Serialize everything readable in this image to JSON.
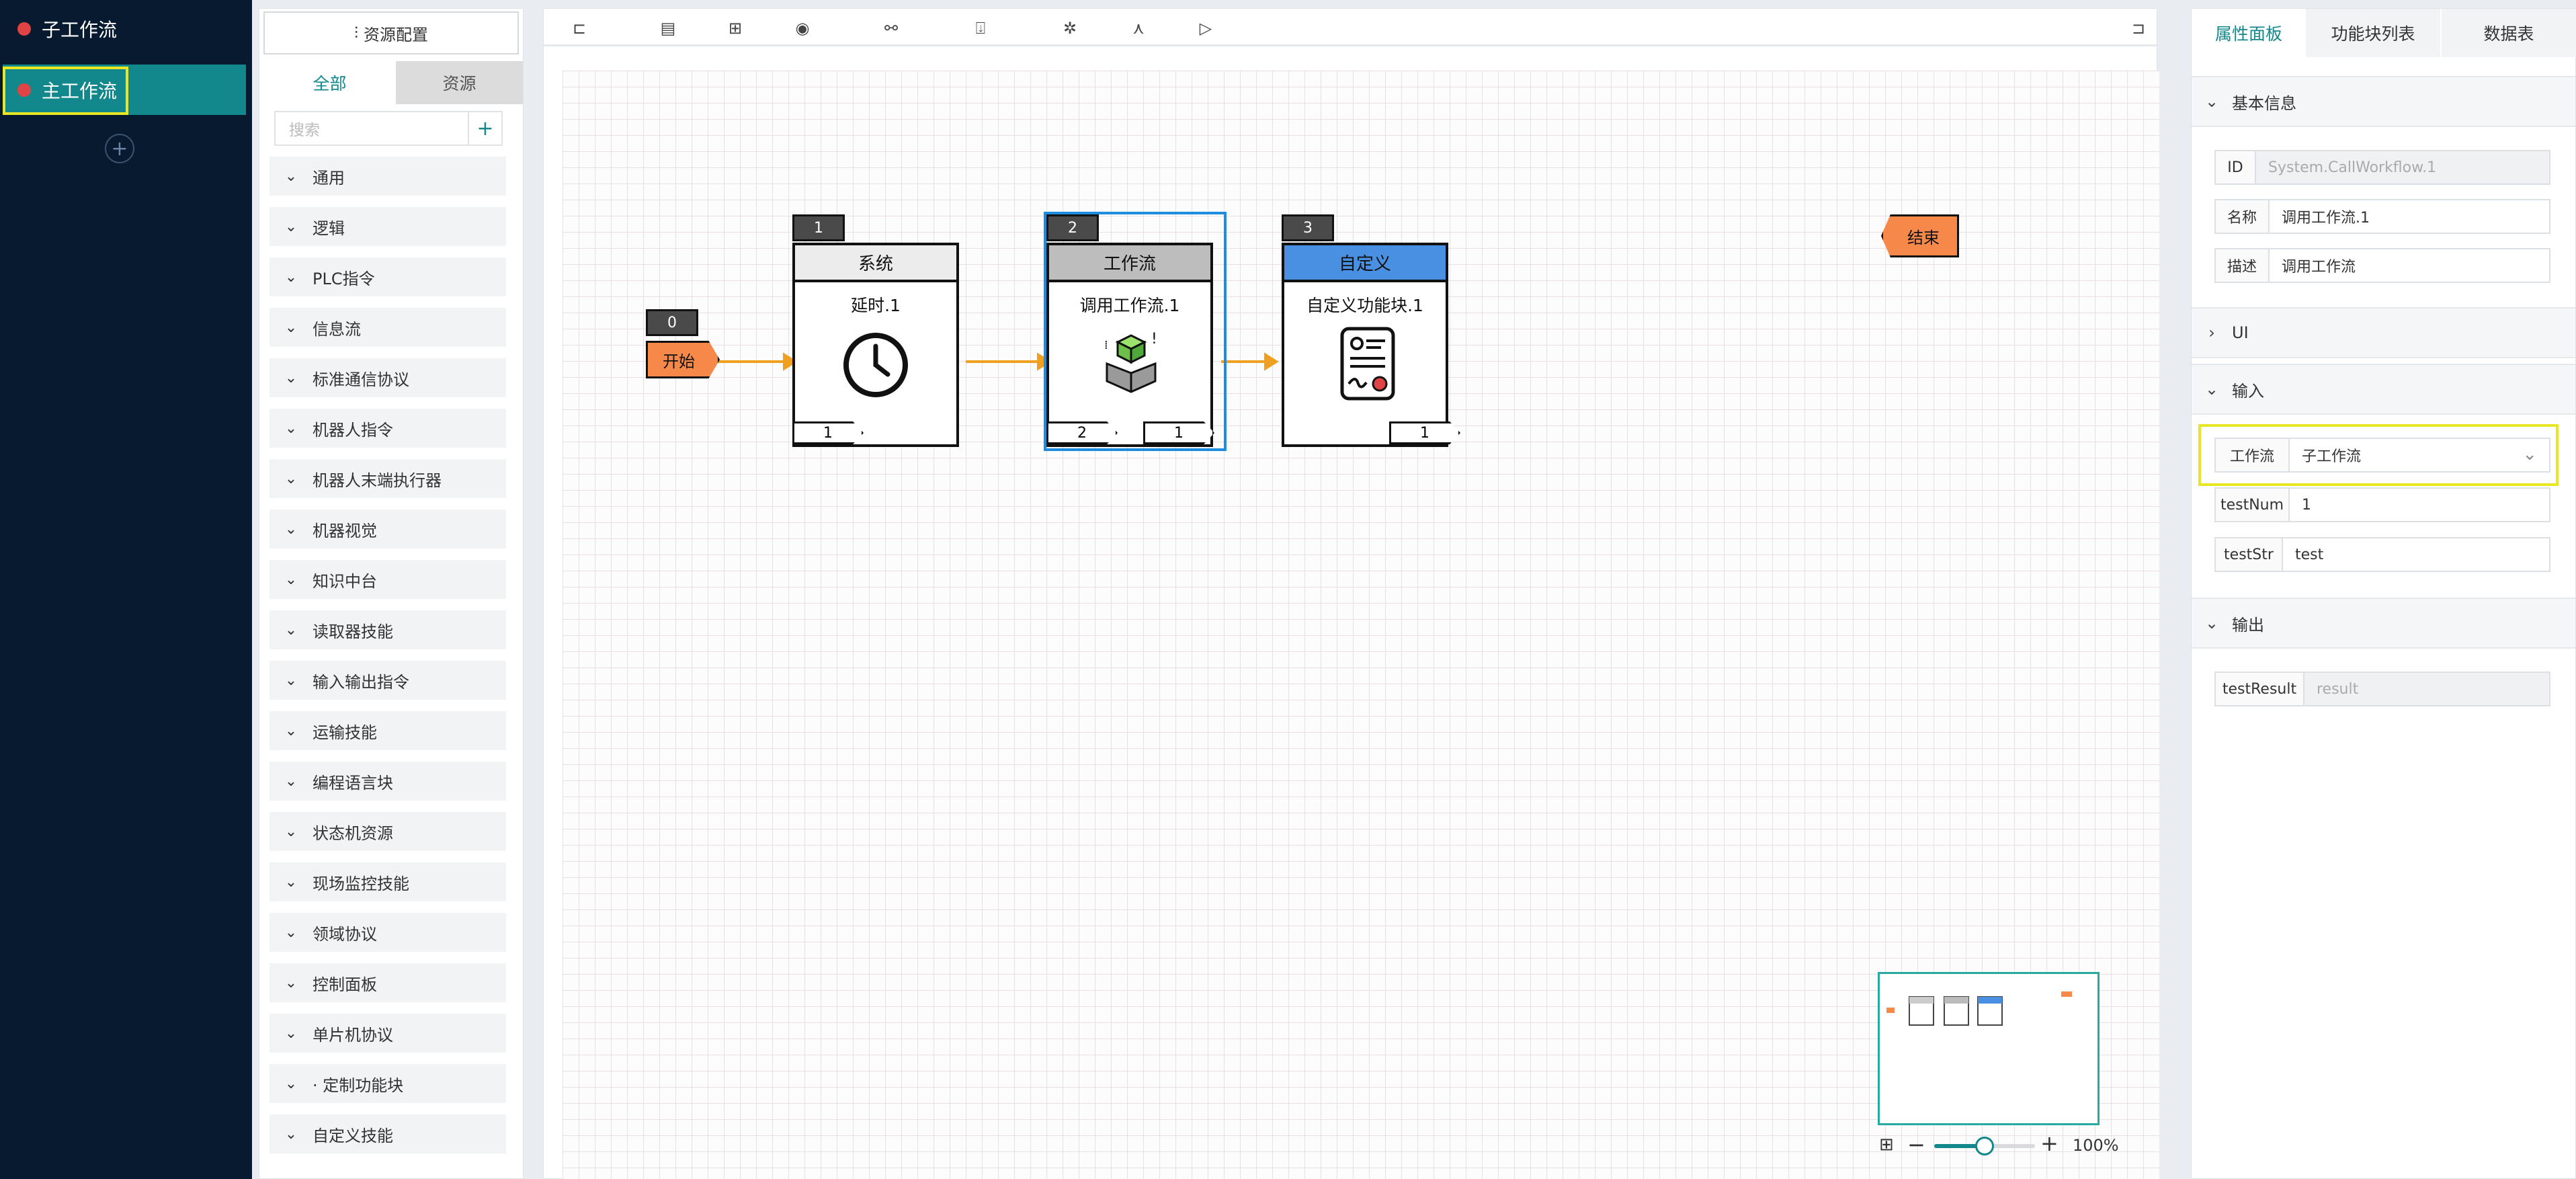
{
  "workflows": {
    "sub": {
      "label": "子工作流",
      "dot_color": "#e04343"
    },
    "main": {
      "label": "主工作流",
      "dot_color": "#e04343"
    },
    "add_symbol": "+"
  },
  "resources": {
    "header": "资源配置",
    "tabs": {
      "all": "全部",
      "resources": "资源"
    },
    "search_placeholder": "搜索",
    "search_add": "+",
    "categories": [
      "通用",
      "逻辑",
      "PLC指令",
      "信息流",
      "标准通信协议",
      "机器人指令",
      "机器人末端执行器",
      "机器视觉",
      "知识中台",
      "读取器技能",
      "输入输出指令",
      "运输技能",
      "编程语言块",
      "状态机资源",
      "现场监控技能",
      "领域协议",
      "控制面板",
      "单片机协议",
      "· 定制功能块",
      "自定义技能"
    ]
  },
  "toolbar": {
    "icons": [
      "collapse-left-icon",
      "save-icon",
      "grid-layout-icon",
      "eye-icon",
      "link-icon",
      "export-icon",
      "debug-icon",
      "graph-icon",
      "run-icon",
      "collapse-right-icon"
    ]
  },
  "canvas": {
    "start": {
      "index": "0",
      "label": "开始"
    },
    "end": {
      "label": "结束"
    },
    "nodes": [
      {
        "index": "1",
        "category": "系统",
        "name": "延时.1",
        "ports_out": [
          "1"
        ],
        "header_color": "#ececec"
      },
      {
        "index": "2",
        "category": "工作流",
        "name": "调用工作流.1",
        "ports_out": [
          "2",
          "1"
        ],
        "header_color": "#bdbdbd"
      },
      {
        "index": "3",
        "category": "自定义",
        "name": "自定义功能块.1",
        "ports_out": [
          "1"
        ],
        "header_color": "#4a90e2"
      }
    ],
    "colors": {
      "accent": "#13888c",
      "start_end": "#f6894a",
      "edge": "#f0a020",
      "selection": "#1e8de0"
    }
  },
  "zoom": {
    "minus": "−",
    "plus": "+",
    "value": "100%",
    "level": 0.5
  },
  "properties": {
    "tabs": {
      "attr": "属性面板",
      "blocks": "功能块列表",
      "data": "数据表"
    },
    "basic": {
      "title": "基本信息",
      "id_label": "ID",
      "id_value": "System.CallWorkflow.1",
      "name_label": "名称",
      "name_value": "调用工作流.1",
      "desc_label": "描述",
      "desc_value": "调用工作流"
    },
    "ui": {
      "title": "UI"
    },
    "input": {
      "title": "输入",
      "workflow_label": "工作流",
      "workflow_value": "子工作流",
      "num_label": "testNum",
      "num_value": "1",
      "str_label": "testStr",
      "str_value": "test"
    },
    "output": {
      "title": "输出",
      "result_label": "testResult",
      "result_value": "result"
    }
  }
}
